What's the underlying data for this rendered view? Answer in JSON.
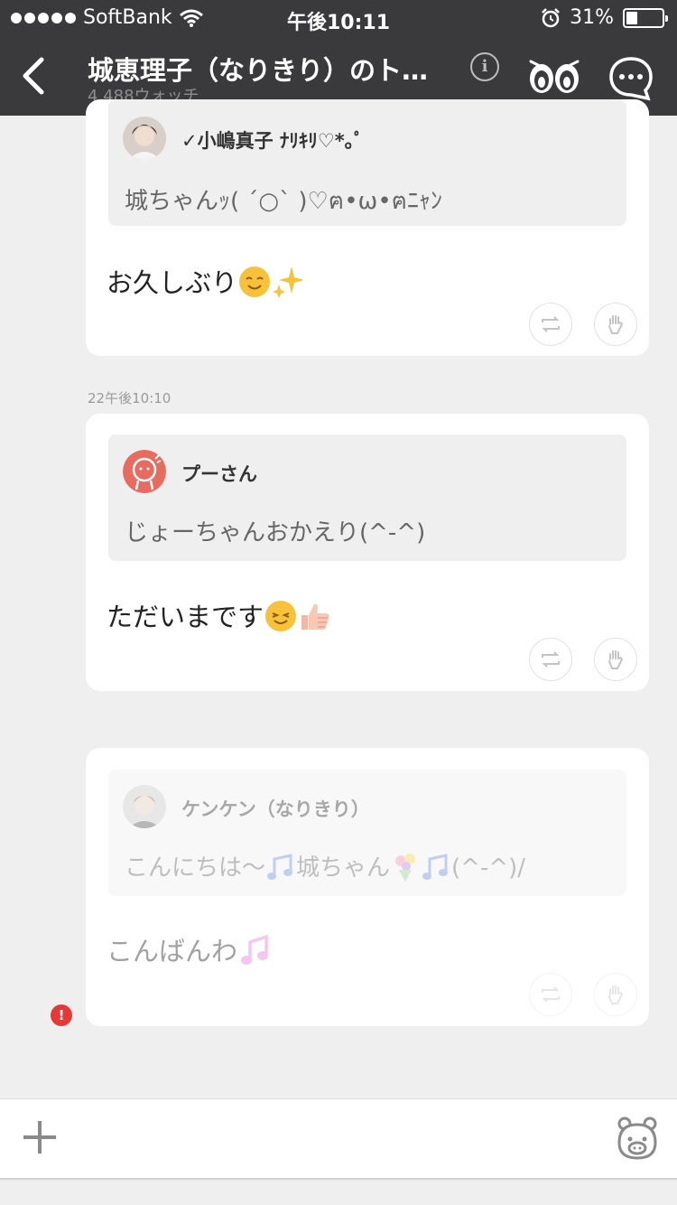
{
  "status_bar": {
    "carrier": "SoftBank",
    "time": "午後10:11",
    "battery": "31%",
    "battery_level": 0.31
  },
  "nav": {
    "title": "城恵理子（なりきり）のト…",
    "subtitle": "4,488ウォッチ"
  },
  "posts": [
    {
      "quote_name": "✓小嶋真子 ﾅﾘｷﾘ♡*｡ﾟ",
      "quote_text": "城ちゃんｯ( ˊ○ˋ )♡ฅ•ω•ฅﾆｬﾝ",
      "message": "お久しぶり",
      "emojis": [
        "smile-emoji",
        "sparkles-emoji"
      ]
    },
    {
      "timestamp": "22午後10:10",
      "quote_name": "プーさん",
      "quote_text": "じょーちゃんおかえり(^-^)",
      "message": "ただいまです",
      "emojis": [
        "smile-emoji",
        "thumbs-up-emoji"
      ]
    },
    {
      "quote_name": "ケンケン（なりきり）",
      "quote_text_parts": [
        "こんにちは〜",
        "城ちゃん",
        "",
        "(^-^)/"
      ],
      "message": "こんばんわ",
      "emojis": [
        "music-note-emoji"
      ],
      "status": "failed"
    }
  ],
  "error_badge": "!",
  "colors": {
    "header": "#3a3a3c",
    "background": "#efeff0",
    "card": "#ffffff",
    "quote_bg": "#efefef",
    "error": "#e53935"
  }
}
